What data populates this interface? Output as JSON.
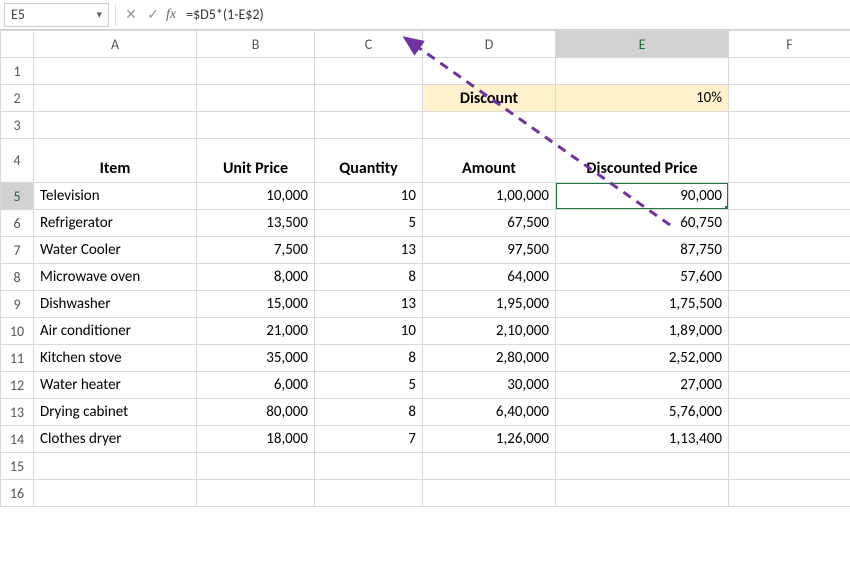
{
  "formula_bar": {
    "name_box": "E5",
    "formula": "=$D5*(1-E$2)"
  },
  "columns": [
    "A",
    "B",
    "C",
    "D",
    "E",
    "F"
  ],
  "row_headers": [
    "1",
    "2",
    "3",
    "4",
    "5",
    "6",
    "7",
    "8",
    "9",
    "10",
    "11",
    "12",
    "13",
    "14",
    "15",
    "16"
  ],
  "row2": {
    "discount_label": "Discount",
    "discount_value": "10%"
  },
  "headers": {
    "A": "Item",
    "B": "Unit Price",
    "C": "Quantity",
    "D": "Amount",
    "E": "Discounted Price"
  },
  "rows": [
    {
      "item": "Television",
      "unit": "10,000",
      "qty": "10",
      "amount": "1,00,000",
      "disc": "90,000"
    },
    {
      "item": "Refrigerator",
      "unit": "13,500",
      "qty": "5",
      "amount": "67,500",
      "disc": "60,750"
    },
    {
      "item": "Water Cooler",
      "unit": "7,500",
      "qty": "13",
      "amount": "97,500",
      "disc": "87,750"
    },
    {
      "item": "Microwave oven",
      "unit": "8,000",
      "qty": "8",
      "amount": "64,000",
      "disc": "57,600"
    },
    {
      "item": "Dishwasher",
      "unit": "15,000",
      "qty": "13",
      "amount": "1,95,000",
      "disc": "1,75,500"
    },
    {
      "item": "Air conditioner",
      "unit": "21,000",
      "qty": "10",
      "amount": "2,10,000",
      "disc": "1,89,000"
    },
    {
      "item": "Kitchen stove",
      "unit": "35,000",
      "qty": "8",
      "amount": "2,80,000",
      "disc": "2,52,000"
    },
    {
      "item": "Water heater",
      "unit": "6,000",
      "qty": "5",
      "amount": "30,000",
      "disc": "27,000"
    },
    {
      "item": "Drying cabinet",
      "unit": "80,000",
      "qty": "8",
      "amount": "6,40,000",
      "disc": "5,76,000"
    },
    {
      "item": "Clothes dryer",
      "unit": "18,000",
      "qty": "7",
      "amount": "1,26,000",
      "disc": "1,13,400"
    }
  ],
  "chart_data": {
    "type": "table",
    "title": "Item pricing with 10% discount",
    "discount_rate_pct": 10,
    "columns": [
      "Item",
      "Unit Price",
      "Quantity",
      "Amount",
      "Discounted Price"
    ],
    "data": [
      [
        "Television",
        10000,
        10,
        100000,
        90000
      ],
      [
        "Refrigerator",
        13500,
        5,
        67500,
        60750
      ],
      [
        "Water Cooler",
        7500,
        13,
        97500,
        87750
      ],
      [
        "Microwave oven",
        8000,
        8,
        64000,
        57600
      ],
      [
        "Dishwasher",
        15000,
        13,
        195000,
        175500
      ],
      [
        "Air conditioner",
        21000,
        10,
        210000,
        189000
      ],
      [
        "Kitchen stove",
        35000,
        8,
        280000,
        252000
      ],
      [
        "Water heater",
        6000,
        5,
        30000,
        27000
      ],
      [
        "Drying cabinet",
        80000,
        8,
        640000,
        576000
      ],
      [
        "Clothes dryer",
        18000,
        7,
        126000,
        113400
      ]
    ]
  }
}
